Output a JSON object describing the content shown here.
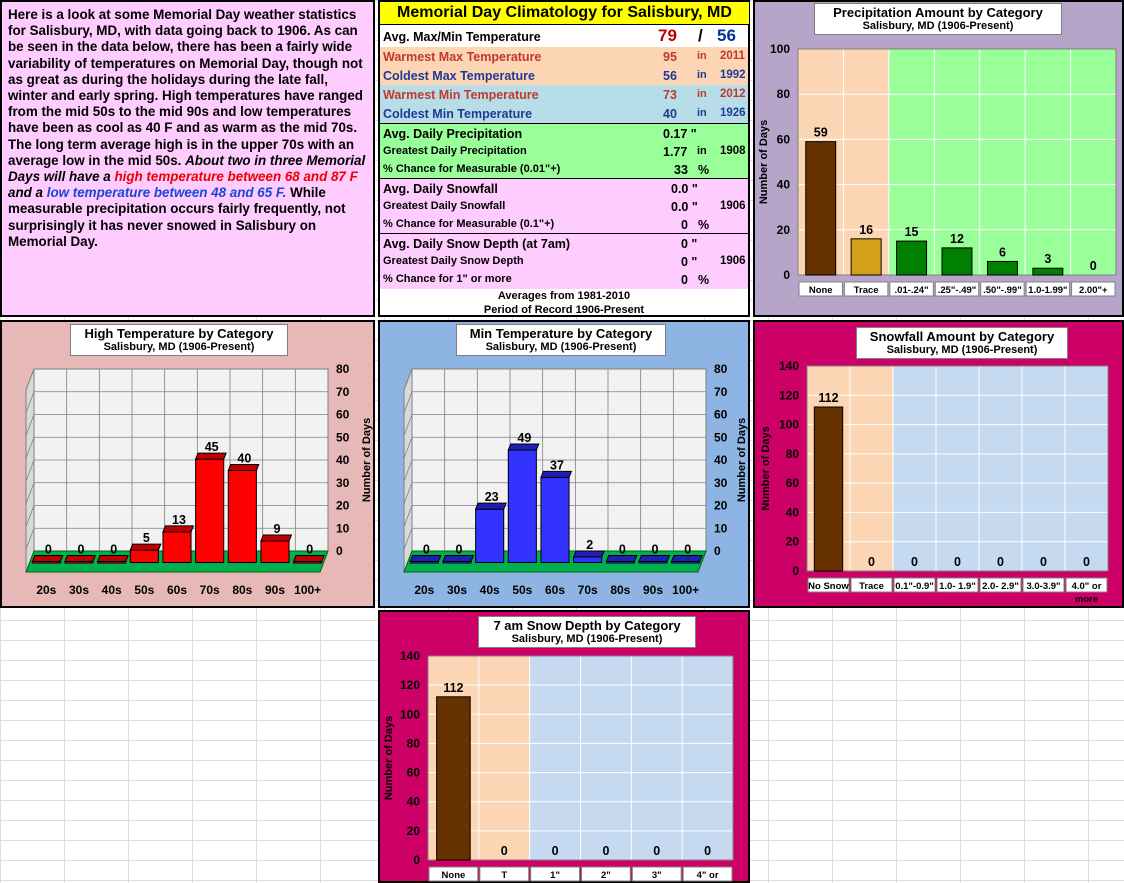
{
  "intro": {
    "p1": "Here is a look at some Memorial Day weather statistics for Salisbury, MD, with data going back to 1906. As can be seen in the data below, there has been a fairly wide variability of temperatures on Memorial Day, though not as great as during the holidays during the late fall, winter and early spring. High temperatures have ranged from the mid 50s to the mid 90s and low temperatures have been as cool as 40 F and as warm as the mid 70s. The long term average high is in the upper 70s with an average low in the mid 50s.",
    "p2": "About two in three Memorial Days will have a",
    "p3": "high temperature between 68 and 87 F",
    "p4": "and a",
    "p5": "low temperature between 48 and 65 F.",
    "p6": "While measurable precipitation occurs fairly frequently, not surprisingly it has never snowed in Salisbury on Memorial Day."
  },
  "clim": {
    "title": "Memorial Day Climatology for Salisbury, MD",
    "avg_label": "Avg. Max/Min Temperature",
    "avg_max": "79",
    "avg_sep": "/",
    "avg_min": "56",
    "warm_max": {
      "label": "Warmest Max Temperature",
      "val": "95",
      "in": "in",
      "yr": "2011"
    },
    "cold_max": {
      "label": "Coldest Max Temperature",
      "val": "56",
      "in": "in",
      "yr": "1992"
    },
    "warm_min": {
      "label": "Warmest Min Temperature",
      "val": "73",
      "in": "in",
      "yr": "2012"
    },
    "cold_min": {
      "label": "Coldest Min Temperature",
      "val": "40",
      "in": "in",
      "yr": "1926"
    },
    "precip": {
      "label": "Avg. Daily Precipitation",
      "val": "0.17 \"",
      "g_label": "Greatest Daily Precipitation",
      "g_val": "1.77",
      "g_in": "in",
      "g_yr": "1908",
      "c_label": "% Chance for Measurable (0.01\"+)",
      "c_val": "33",
      "c_pct": "%"
    },
    "snow": {
      "label": "Avg. Daily Snowfall",
      "val": "0.0 \"",
      "g_label": "Greatest Daily Snowfall",
      "g_val": "0.0 \"",
      "g_yr": "1906",
      "c_label": "% Chance for Measurable (0.1\"+)",
      "c_val": "0",
      "c_pct": "%"
    },
    "depth": {
      "label": "Avg. Daily Snow Depth (at 7am)",
      "val": "0 \"",
      "g_label": "Greatest Daily Snow Depth",
      "g_val": "0 \"",
      "g_yr": "1906",
      "c_label": "% Chance for 1\" or more",
      "c_val": "0",
      "c_pct": "%"
    },
    "foot1": "Averages from 1981-2010",
    "foot2": "Period of Record 1906-Present"
  },
  "colors": {
    "precip_bg": "#b7a5c9",
    "high_bg": "#e6b8b7",
    "min_bg": "#8db4e2",
    "snow_bg": "#cc0066",
    "orange_plot": "#fcd5b4",
    "green_plot": "#99ff99",
    "blue_plot": "#c5d9f1",
    "brown": "#663300",
    "gold": "#d4a017",
    "green": "#008000",
    "red": "#ff0000",
    "blue": "#3333ff"
  },
  "chart_data": [
    {
      "id": "precip",
      "type": "bar",
      "title": "Precipitation Amount by Category",
      "subtitle": "Salisbury, MD (1906-Present)",
      "categories": [
        "None",
        "Trace",
        ".01-.24\"",
        ".25\"-.49\"",
        ".50\"-.99\"",
        "1.0-1.99\"",
        "2.00\"+"
      ],
      "values": [
        59,
        16,
        15,
        12,
        6,
        3,
        0
      ],
      "colors": [
        "#663300",
        "#d4a017",
        "#008000",
        "#008000",
        "#008000",
        "#008000",
        "#008000"
      ],
      "ylabel": "Number of Days",
      "ylim": [
        0,
        100
      ],
      "yticks": [
        0,
        20,
        40,
        60,
        80,
        100
      ],
      "grid": true
    },
    {
      "id": "high",
      "type": "bar",
      "title": "High Temperature by Category",
      "subtitle": "Salisbury, MD (1906-Present)",
      "categories": [
        "20s",
        "30s",
        "40s",
        "50s",
        "60s",
        "70s",
        "80s",
        "90s",
        "100+"
      ],
      "values": [
        0,
        0,
        0,
        5,
        13,
        45,
        40,
        9,
        0
      ],
      "ylabel": "Number of Days",
      "ylim": [
        0,
        80
      ],
      "yticks": [
        0,
        10,
        20,
        30,
        40,
        50,
        60,
        70,
        80
      ],
      "grid": true
    },
    {
      "id": "min",
      "type": "bar",
      "title": "Min Temperature by Category",
      "subtitle": "Salisbury, MD (1906-Present)",
      "categories": [
        "20s",
        "30s",
        "40s",
        "50s",
        "60s",
        "70s",
        "80s",
        "90s",
        "100+"
      ],
      "values": [
        0,
        0,
        23,
        49,
        37,
        2,
        0,
        0,
        0
      ],
      "ylabel": "Number of Days",
      "ylim": [
        0,
        80
      ],
      "yticks": [
        0,
        10,
        20,
        30,
        40,
        50,
        60,
        70,
        80
      ],
      "grid": true
    },
    {
      "id": "snow",
      "type": "bar",
      "title": "Snowfall Amount  by Category",
      "subtitle": "Salisbury, MD (1906-Present)",
      "categories": [
        "No Snow",
        "Trace",
        "0.1\"-0.9\"",
        "1.0- 1.9\"",
        "2.0- 2.9\"",
        "3.0-3.9\"",
        "4.0\" or more"
      ],
      "values": [
        112,
        0,
        0,
        0,
        0,
        0,
        0
      ],
      "ylabel": "Number of Days",
      "ylim": [
        0,
        140
      ],
      "yticks": [
        0,
        20,
        40,
        60,
        80,
        100,
        120,
        140
      ],
      "grid": true
    },
    {
      "id": "depth",
      "type": "bar",
      "title": "7 am  Snow Depth by Category",
      "subtitle": "Salisbury, MD (1906-Present)",
      "categories": [
        "None",
        "T",
        "1\"",
        "2\"",
        "3\"",
        "4\" or"
      ],
      "values": [
        112,
        0,
        0,
        0,
        0,
        0
      ],
      "ylabel": "Number of Days",
      "ylim": [
        0,
        140
      ],
      "yticks": [
        0,
        20,
        40,
        60,
        80,
        100,
        120,
        140
      ],
      "grid": true
    }
  ]
}
